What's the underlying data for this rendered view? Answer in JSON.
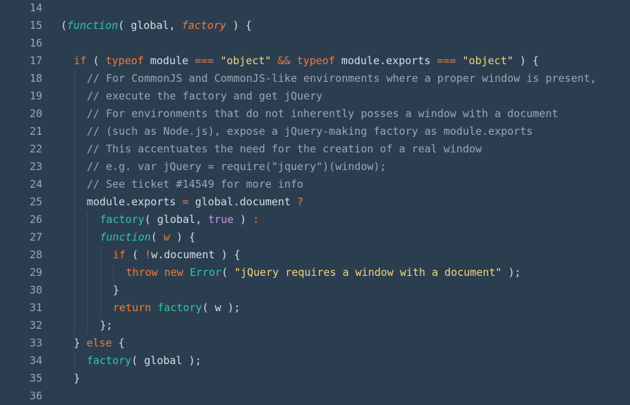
{
  "editor": {
    "language": "javascript",
    "colors": {
      "background": "#2b3e50",
      "text": "#d6dde6",
      "line_number": "#9aa7b4",
      "keyword": "#f07a3c",
      "function": "#2ec8a0",
      "string": "#f2d57e",
      "comment": "#9aa7b4",
      "boolean": "#c59be6"
    },
    "lines": [
      {
        "num": "14",
        "indent": 0,
        "tokens": []
      },
      {
        "num": "15",
        "indent": 0,
        "tokens": [
          {
            "t": "(",
            "c": "plain"
          },
          {
            "t": "function",
            "c": "fn"
          },
          {
            "t": "( global, ",
            "c": "plain"
          },
          {
            "t": "factory",
            "c": "param"
          },
          {
            "t": " ) {",
            "c": "plain"
          }
        ]
      },
      {
        "num": "16",
        "indent": 0,
        "tokens": []
      },
      {
        "num": "17",
        "indent": 1,
        "tokens": [
          {
            "t": "if",
            "c": "kw"
          },
          {
            "t": " ( ",
            "c": "plain"
          },
          {
            "t": "typeof",
            "c": "kw"
          },
          {
            "t": " module ",
            "c": "plain"
          },
          {
            "t": "===",
            "c": "op"
          },
          {
            "t": " ",
            "c": "plain"
          },
          {
            "t": "\"object\"",
            "c": "str"
          },
          {
            "t": " ",
            "c": "plain"
          },
          {
            "t": "&&",
            "c": "op"
          },
          {
            "t": " ",
            "c": "plain"
          },
          {
            "t": "typeof",
            "c": "kw"
          },
          {
            "t": " module.exports ",
            "c": "plain"
          },
          {
            "t": "===",
            "c": "op"
          },
          {
            "t": " ",
            "c": "plain"
          },
          {
            "t": "\"object\"",
            "c": "str"
          },
          {
            "t": " ) {",
            "c": "plain"
          }
        ]
      },
      {
        "num": "18",
        "indent": 2,
        "tokens": [
          {
            "t": "// For CommonJS and CommonJS-like environments where a proper window is present,",
            "c": "comment"
          }
        ]
      },
      {
        "num": "19",
        "indent": 2,
        "tokens": [
          {
            "t": "// execute the factory and get jQuery",
            "c": "comment"
          }
        ]
      },
      {
        "num": "20",
        "indent": 2,
        "tokens": [
          {
            "t": "// For environments that do not inherently posses a window with a document",
            "c": "comment"
          }
        ]
      },
      {
        "num": "21",
        "indent": 2,
        "tokens": [
          {
            "t": "// (such as Node.js), expose a jQuery-making factory as module.exports",
            "c": "comment"
          }
        ]
      },
      {
        "num": "22",
        "indent": 2,
        "tokens": [
          {
            "t": "// This accentuates the need for the creation of a real window",
            "c": "comment"
          }
        ]
      },
      {
        "num": "23",
        "indent": 2,
        "tokens": [
          {
            "t": "// e.g. var jQuery = require(\"jquery\")(window);",
            "c": "comment"
          }
        ]
      },
      {
        "num": "24",
        "indent": 2,
        "tokens": [
          {
            "t": "// See ticket #14549 for more info",
            "c": "comment"
          }
        ]
      },
      {
        "num": "25",
        "indent": 2,
        "tokens": [
          {
            "t": "module.exports ",
            "c": "plain"
          },
          {
            "t": "=",
            "c": "op"
          },
          {
            "t": " global.document ",
            "c": "plain"
          },
          {
            "t": "?",
            "c": "op"
          }
        ]
      },
      {
        "num": "26",
        "indent": 3,
        "tokens": [
          {
            "t": "factory",
            "c": "call"
          },
          {
            "t": "( global, ",
            "c": "plain"
          },
          {
            "t": "true",
            "c": "bool"
          },
          {
            "t": " ) ",
            "c": "plain"
          },
          {
            "t": ":",
            "c": "op"
          }
        ]
      },
      {
        "num": "27",
        "indent": 3,
        "tokens": [
          {
            "t": "function",
            "c": "fn"
          },
          {
            "t": "( ",
            "c": "plain"
          },
          {
            "t": "w",
            "c": "param"
          },
          {
            "t": " ) {",
            "c": "plain"
          }
        ]
      },
      {
        "num": "28",
        "indent": 4,
        "tokens": [
          {
            "t": "if",
            "c": "kw"
          },
          {
            "t": " ( ",
            "c": "plain"
          },
          {
            "t": "!",
            "c": "op"
          },
          {
            "t": "w.document ) {",
            "c": "plain"
          }
        ]
      },
      {
        "num": "29",
        "indent": 5,
        "tokens": [
          {
            "t": "throw",
            "c": "kw"
          },
          {
            "t": " ",
            "c": "plain"
          },
          {
            "t": "new",
            "c": "kw"
          },
          {
            "t": " ",
            "c": "plain"
          },
          {
            "t": "Error",
            "c": "class"
          },
          {
            "t": "( ",
            "c": "plain"
          },
          {
            "t": "\"jQuery requires a window with a document\"",
            "c": "str"
          },
          {
            "t": " );",
            "c": "plain"
          }
        ]
      },
      {
        "num": "30",
        "indent": 4,
        "tokens": [
          {
            "t": "}",
            "c": "plain"
          }
        ]
      },
      {
        "num": "31",
        "indent": 4,
        "tokens": [
          {
            "t": "return",
            "c": "kw"
          },
          {
            "t": " ",
            "c": "plain"
          },
          {
            "t": "factory",
            "c": "call"
          },
          {
            "t": "( w );",
            "c": "plain"
          }
        ]
      },
      {
        "num": "32",
        "indent": 3,
        "tokens": [
          {
            "t": "};",
            "c": "plain"
          }
        ]
      },
      {
        "num": "33",
        "indent": 1,
        "tokens": [
          {
            "t": "} ",
            "c": "plain"
          },
          {
            "t": "else",
            "c": "kw"
          },
          {
            "t": " {",
            "c": "plain"
          }
        ]
      },
      {
        "num": "34",
        "indent": 2,
        "tokens": [
          {
            "t": "factory",
            "c": "call"
          },
          {
            "t": "( global );",
            "c": "plain"
          }
        ]
      },
      {
        "num": "35",
        "indent": 1,
        "tokens": [
          {
            "t": "}",
            "c": "plain"
          }
        ]
      },
      {
        "num": "36",
        "indent": 0,
        "tokens": []
      }
    ]
  }
}
